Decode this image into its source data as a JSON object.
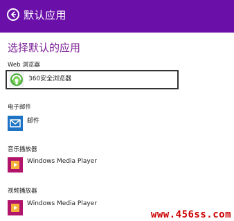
{
  "header": {
    "title": "默认应用",
    "back_icon": "back-arrow-circle-icon",
    "background_color": "#6a0fa8"
  },
  "page_title": "选择默认的应用",
  "sections": [
    {
      "label": "Web 浏览器",
      "app": {
        "name": "360安全浏览器",
        "icon": "360-browser-icon",
        "selected": true
      }
    },
    {
      "label": "电子邮件",
      "app": {
        "name": "邮件",
        "icon": "mail-icon",
        "selected": false
      }
    },
    {
      "label": "音乐播放器",
      "app": {
        "name": "Windows Media Player",
        "icon": "windows-media-player-icon",
        "selected": false
      }
    },
    {
      "label": "视频播放器",
      "app": {
        "name": "Windows Media Player",
        "icon": "windows-media-player-icon",
        "selected": false
      }
    }
  ],
  "watermark": "www.456ss.com"
}
